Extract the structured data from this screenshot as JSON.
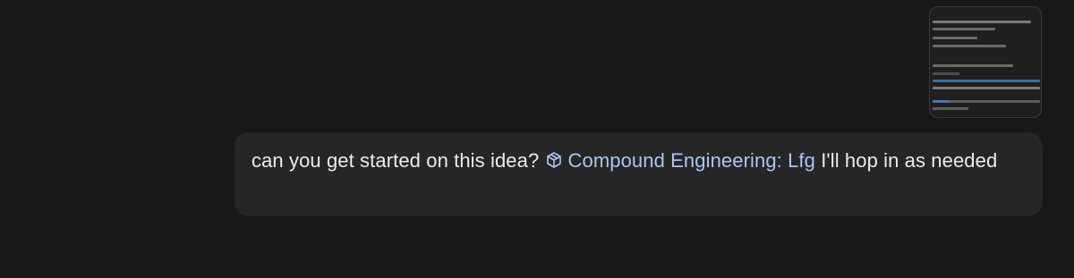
{
  "message": {
    "text_before": "can you get started on this idea?",
    "mention": {
      "label": "Compound Engineering: Lfg",
      "icon": "cube-icon",
      "color": "#a9c6f5"
    },
    "text_after": "I'll hop in as needed"
  },
  "attachment": {
    "type": "image-thumbnail"
  },
  "colors": {
    "background": "#181818",
    "bubble": "#262626",
    "text": "#ececec"
  }
}
